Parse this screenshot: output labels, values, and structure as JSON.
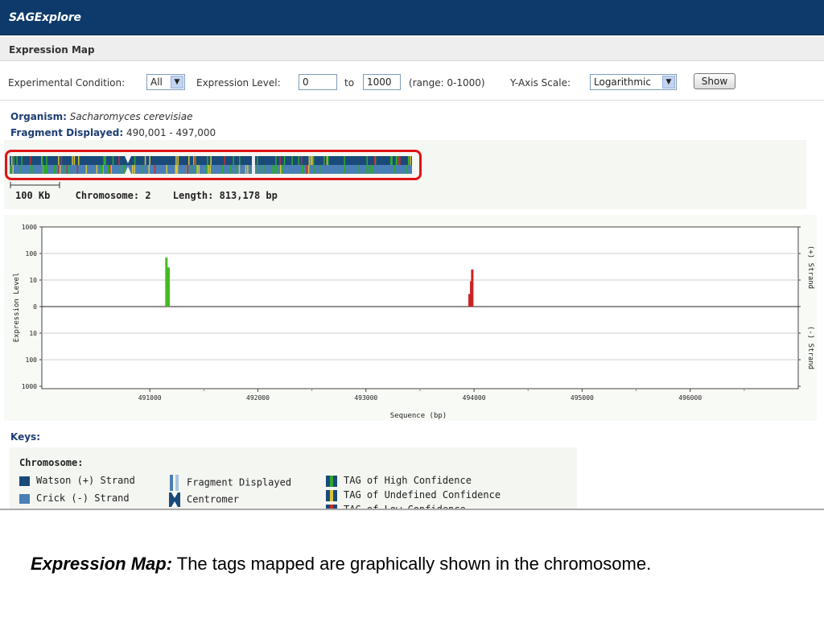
{
  "app": {
    "brand": "SAGExplore"
  },
  "page": {
    "heading": "Expression Map"
  },
  "controls": {
    "condition_label": "Experimental Condition:",
    "condition_value": "All",
    "level_label": "Expression Level:",
    "level_min": "0",
    "to_label": "to",
    "level_max": "1000",
    "range_text": "(range: 0-1000)",
    "scale_label": "Y-Axis Scale:",
    "scale_value": "Logarithmic",
    "show_button": "Show"
  },
  "info": {
    "organism_label": "Organism:",
    "organism_value": "Sacharomyces cerevisiae",
    "fragment_label": "Fragment Displayed:",
    "fragment_value": "490,001 - 497,000"
  },
  "chromosome": {
    "scale_label": "100 Kb",
    "chromosome_label": "Chromosome:",
    "chromosome_value": "2",
    "length_label": "Length:",
    "length_value": "813,178 bp",
    "colors": {
      "watson": "#1a4a7a",
      "crick": "#4a7fb5",
      "high": "#2fa82f",
      "undefined": "#d8c53a",
      "low": "#c03030"
    }
  },
  "chart_data": {
    "type": "bar",
    "xlabel": "Sequence (bp)",
    "ylabel": "Expression Level",
    "right_label_top": "(+) Strand",
    "right_label_bottom": "(-) Strand",
    "x_ticks": [
      "491000",
      "492000",
      "493000",
      "494000",
      "495000",
      "496000"
    ],
    "y_ticks_top": [
      "1000",
      "100",
      "10",
      "0"
    ],
    "y_ticks_bottom": [
      "10",
      "100",
      "1000"
    ],
    "xlim": [
      490001,
      497000
    ],
    "y_scale": "log",
    "series": [
      {
        "strand": "+",
        "color": "#44bb22",
        "points": [
          {
            "x": 491150,
            "y": 70
          },
          {
            "x": 491170,
            "y": 30
          }
        ]
      },
      {
        "strand": "+",
        "color": "#cc2222",
        "points": [
          {
            "x": 493955,
            "y": 3
          },
          {
            "x": 493970,
            "y": 9
          },
          {
            "x": 493980,
            "y": 25
          }
        ]
      }
    ]
  },
  "keys": {
    "title": "Keys:",
    "chromosome_heading": "Chromosome:",
    "watson": "Watson (+) Strand",
    "crick": "Crick  (-) Strand",
    "fragment": "Fragment Displayed",
    "centromer": "Centromer",
    "tag_high": "TAG of High Confidence",
    "tag_undefined": "TAG of Undefined Confidence",
    "tag_low": "TAG of Low Confidence"
  },
  "caption": {
    "lead": "Expression Map:",
    "text": " The tags mapped are graphically shown in the chromosome."
  }
}
